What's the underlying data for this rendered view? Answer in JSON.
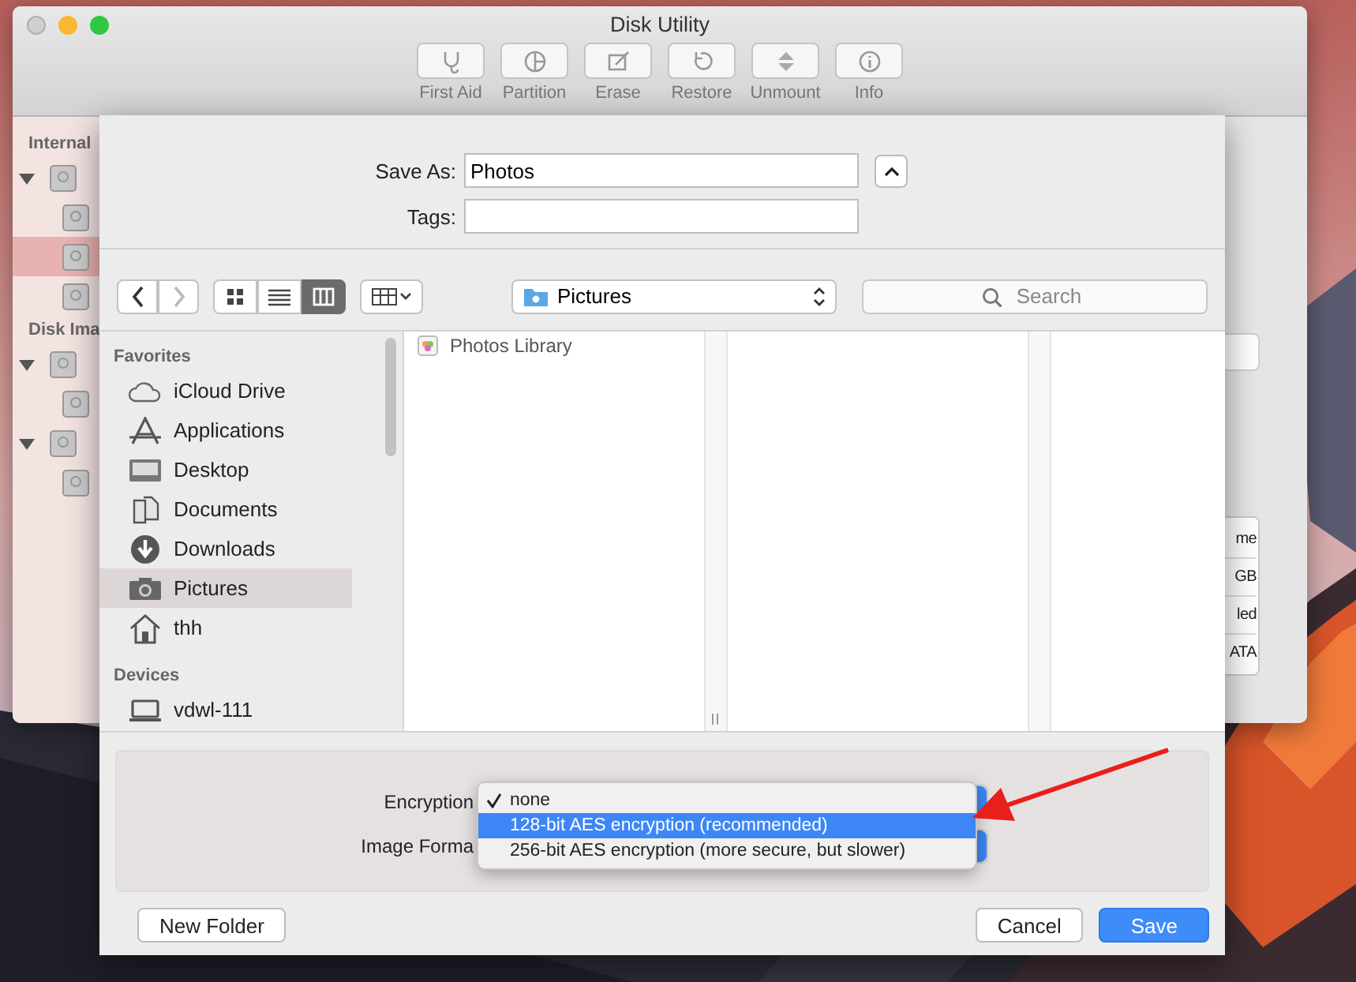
{
  "window": {
    "title": "Disk Utility",
    "toolbar": [
      {
        "label": "First Aid",
        "disabled": true
      },
      {
        "label": "Partition",
        "disabled": true
      },
      {
        "label": "Erase",
        "disabled": true
      },
      {
        "label": "Restore",
        "disabled": true
      },
      {
        "label": "Unmount",
        "disabled": true
      },
      {
        "label": "Info",
        "disabled": true
      }
    ],
    "sidebar": [
      {
        "title": "Internal",
        "items": [
          {
            "expanded": true,
            "selected": false,
            "children": [
              {
                "selected": false
              },
              {
                "selected": true
              },
              {
                "selected": false
              }
            ]
          }
        ]
      },
      {
        "title": "Disk Ima",
        "items": [
          {
            "expanded": true,
            "selected": false,
            "children": [
              {
                "selected": false
              }
            ]
          },
          {
            "expanded": true,
            "selected": false,
            "children": [
              {
                "selected": false
              }
            ]
          }
        ]
      }
    ],
    "info_table": [
      "me",
      "GB",
      "led",
      "ATA"
    ]
  },
  "save_sheet": {
    "save_as": {
      "label": "Save As:",
      "value": "Photos"
    },
    "tags": {
      "label": "Tags:"
    },
    "view_modes": [
      {
        "selected": false
      },
      {
        "selected": false
      },
      {
        "selected": true
      }
    ],
    "location": "Pictures",
    "search": {
      "placeholder": "Search"
    },
    "sidebar": [
      {
        "title": "Favorites",
        "items": [
          {
            "label": "iCloud Drive",
            "selected": false
          },
          {
            "label": "Applications",
            "selected": false
          },
          {
            "label": "Desktop",
            "selected": false
          },
          {
            "label": "Documents",
            "selected": false
          },
          {
            "label": "Downloads",
            "selected": false
          },
          {
            "label": "Pictures",
            "selected": true
          },
          {
            "label": "thh",
            "selected": false
          }
        ]
      },
      {
        "title": "Devices",
        "items": [
          {
            "label": "vdwl-111",
            "selected": false
          }
        ]
      }
    ],
    "columns": [
      {
        "items": [
          "Photos Library"
        ]
      }
    ],
    "options": {
      "encryption_label": "Encryption",
      "image_format_label": "Image Forma",
      "menu": [
        {
          "label": "none",
          "checked": true,
          "selected": false
        },
        {
          "label": "128-bit AES encryption (recommended)",
          "checked": false,
          "selected": true
        },
        {
          "label": "256-bit AES encryption (more secure, but slower)",
          "checked": false,
          "selected": false
        }
      ]
    },
    "buttons": [
      {
        "label": "New Folder",
        "default": false
      },
      {
        "label": "Cancel",
        "default": false
      },
      {
        "label": "Save",
        "default": true
      }
    ]
  }
}
